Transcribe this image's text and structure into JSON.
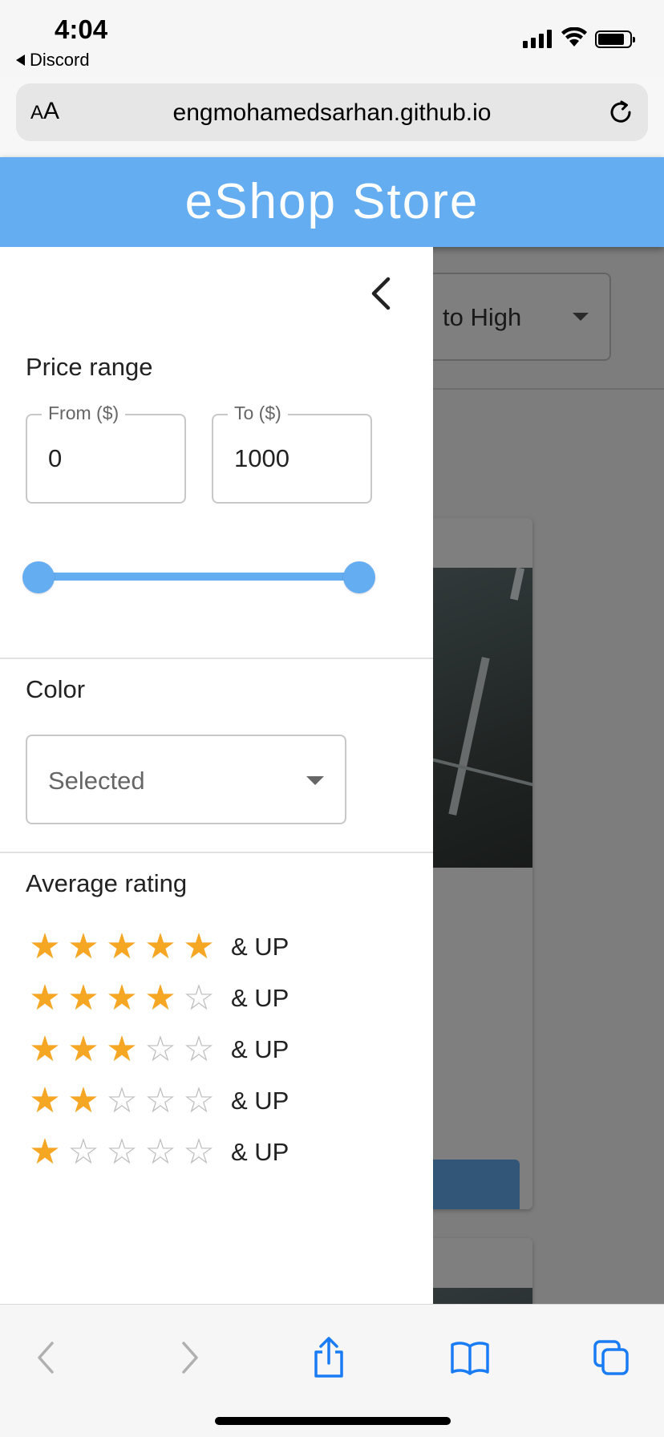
{
  "status_bar": {
    "time": "4:04",
    "back_app": "Discord"
  },
  "browser": {
    "text_size_label_small": "A",
    "text_size_label_large": "A",
    "url": "engmohamedsarhan.github.io"
  },
  "header": {
    "title": "eShop Store"
  },
  "background": {
    "sort_label": "to High"
  },
  "filters": {
    "price": {
      "title": "Price range",
      "from_label": "From ($)",
      "from_value": "0",
      "to_label": "To ($)",
      "to_value": "1000",
      "slider_min": 0,
      "slider_max": 1000
    },
    "color": {
      "title": "Color",
      "selected": "Selected"
    },
    "rating": {
      "title": "Average rating",
      "rows": [
        {
          "stars": 5,
          "label": "& UP"
        },
        {
          "stars": 4,
          "label": "& UP"
        },
        {
          "stars": 3,
          "label": "& UP"
        },
        {
          "stars": 2,
          "label": "& UP"
        },
        {
          "stars": 1,
          "label": "& UP"
        }
      ]
    }
  },
  "colors": {
    "accent": "#64adf1",
    "star": "#f5a623"
  },
  "icons": {
    "drawer_close": "chevron-left-icon",
    "toolbar": [
      "back-icon",
      "forward-icon",
      "share-icon",
      "bookmarks-icon",
      "tabs-icon"
    ]
  }
}
